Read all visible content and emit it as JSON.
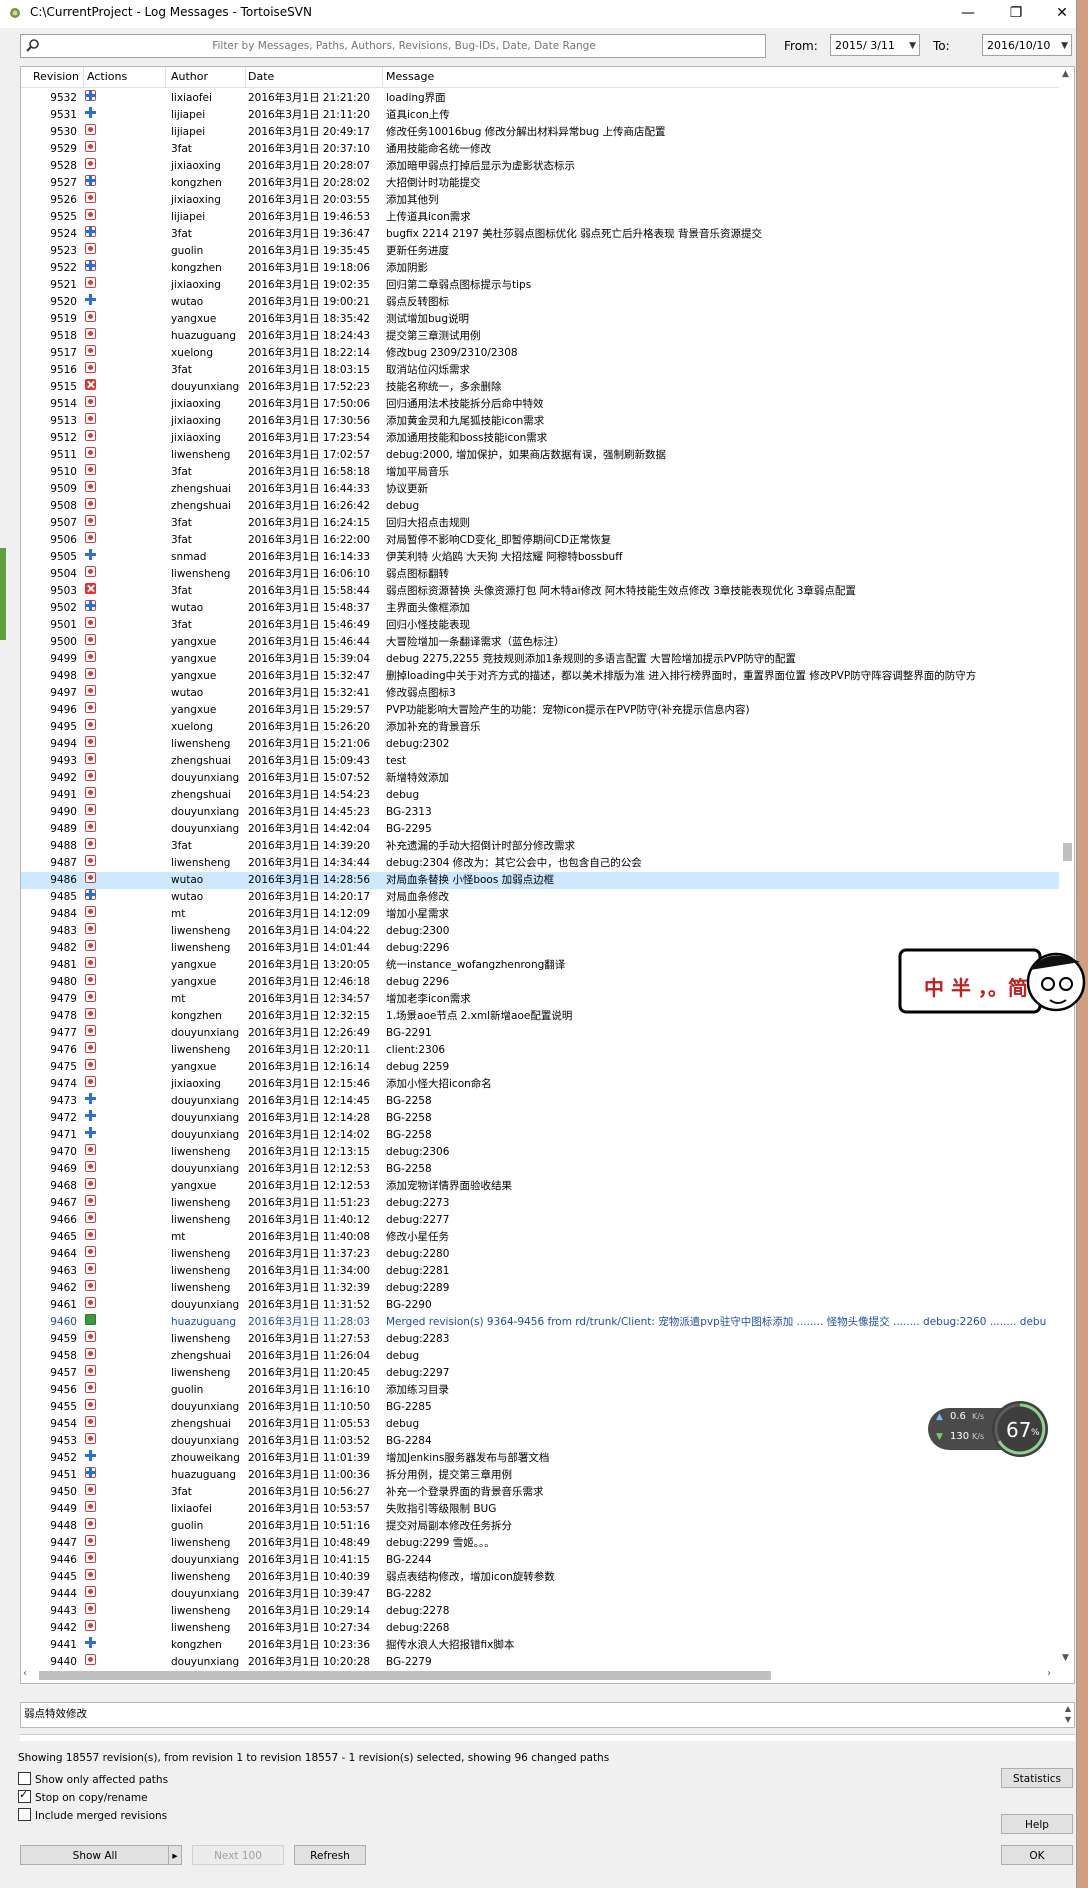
{
  "window": {
    "title": "C:\\CurrentProject - Log Messages - TortoiseSVN",
    "minimize": "—",
    "restore": "❐",
    "close": "✕"
  },
  "filter": {
    "placeholder": "Filter by Messages, Paths, Authors, Revisions, Bug-IDs, Date, Date Range",
    "from_label": "From:",
    "from_value": "2015/ 3/11",
    "to_label": "To:",
    "to_value": "2016/10/10"
  },
  "columns": {
    "revision": "Revision",
    "actions": "Actions",
    "author": "Author",
    "date": "Date",
    "message": "Message"
  },
  "rows": [
    {
      "rev": "9532",
      "a": [
        "mod",
        "add"
      ],
      "author": "lixiaofei",
      "date": "2016年3月1日 21:21:20",
      "msg": "loading界面"
    },
    {
      "rev": "9531",
      "a": [
        "",
        "add"
      ],
      "author": "lijiapei",
      "date": "2016年3月1日 21:11:20",
      "msg": "道具icon上传"
    },
    {
      "rev": "9530",
      "a": [
        "mod"
      ],
      "author": "lijiapei",
      "date": "2016年3月1日 20:49:17",
      "msg": "修改任务10016bug 修改分解出材料异常bug 上传商店配置"
    },
    {
      "rev": "9529",
      "a": [
        "mod"
      ],
      "author": "3fat",
      "date": "2016年3月1日 20:37:10",
      "msg": "通用技能命名统一修改"
    },
    {
      "rev": "9528",
      "a": [
        "mod"
      ],
      "author": "jixiaoxing",
      "date": "2016年3月1日 20:28:07",
      "msg": "添加暗甲弱点打掉后显示为虚影状态标示"
    },
    {
      "rev": "9527",
      "a": [
        "mod",
        "add"
      ],
      "author": "kongzhen",
      "date": "2016年3月1日 20:28:02",
      "msg": "大招倒计时功能提交"
    },
    {
      "rev": "9526",
      "a": [
        "mod"
      ],
      "author": "jixiaoxing",
      "date": "2016年3月1日 20:03:55",
      "msg": "添加其他列"
    },
    {
      "rev": "9525",
      "a": [
        "mod"
      ],
      "author": "lijiapei",
      "date": "2016年3月1日 19:46:53",
      "msg": "上传道具icon需求"
    },
    {
      "rev": "9524",
      "a": [
        "mod",
        "add"
      ],
      "author": "3fat",
      "date": "2016年3月1日 19:36:47",
      "msg": "bugfix 2214 2197 美杜莎弱点图标优化 弱点死亡后升格表现 背景音乐资源提交"
    },
    {
      "rev": "9523",
      "a": [
        "mod"
      ],
      "author": "guolin",
      "date": "2016年3月1日 19:35:45",
      "msg": "更新任务进度"
    },
    {
      "rev": "9522",
      "a": [
        "mod",
        "add"
      ],
      "author": "kongzhen",
      "date": "2016年3月1日 19:18:06",
      "msg": "添加阴影"
    },
    {
      "rev": "9521",
      "a": [
        "mod"
      ],
      "author": "jixiaoxing",
      "date": "2016年3月1日 19:02:35",
      "msg": "回归第二章弱点图标提示与tips"
    },
    {
      "rev": "9520",
      "a": [
        "",
        "add"
      ],
      "author": "wutao",
      "date": "2016年3月1日 19:00:21",
      "msg": "弱点反转图标"
    },
    {
      "rev": "9519",
      "a": [
        "mod"
      ],
      "author": "yangxue",
      "date": "2016年3月1日 18:35:42",
      "msg": "测试增加bug说明"
    },
    {
      "rev": "9518",
      "a": [
        "mod"
      ],
      "author": "huazuguang",
      "date": "2016年3月1日 18:24:43",
      "msg": "提交第三章测试用例"
    },
    {
      "rev": "9517",
      "a": [
        "mod"
      ],
      "author": "xuelong",
      "date": "2016年3月1日 18:22:14",
      "msg": "修改bug 2309/2310/2308"
    },
    {
      "rev": "9516",
      "a": [
        "mod"
      ],
      "author": "3fat",
      "date": "2016年3月1日 18:03:15",
      "msg": "取消站位闪烁需求"
    },
    {
      "rev": "9515",
      "a": [
        "",
        "add",
        "del"
      ],
      "author": "douyunxiang",
      "date": "2016年3月1日 17:52:23",
      "msg": "技能名称统一，多余删除"
    },
    {
      "rev": "9514",
      "a": [
        "mod"
      ],
      "author": "jixiaoxing",
      "date": "2016年3月1日 17:50:06",
      "msg": "回归通用法术技能拆分后命中特效"
    },
    {
      "rev": "9513",
      "a": [
        "mod"
      ],
      "author": "jixiaoxing",
      "date": "2016年3月1日 17:30:56",
      "msg": "添加黄金灵和九尾狐技能icon需求"
    },
    {
      "rev": "9512",
      "a": [
        "mod"
      ],
      "author": "jixiaoxing",
      "date": "2016年3月1日 17:23:54",
      "msg": "添加通用技能和boss技能icon需求"
    },
    {
      "rev": "9511",
      "a": [
        "mod"
      ],
      "author": "liwensheng",
      "date": "2016年3月1日 17:02:57",
      "msg": "debug:2000, 增加保护，如果商店数据有误，强制刷新数据"
    },
    {
      "rev": "9510",
      "a": [
        "mod"
      ],
      "author": "3fat",
      "date": "2016年3月1日 16:58:18",
      "msg": "增加平局音乐"
    },
    {
      "rev": "9509",
      "a": [
        "mod"
      ],
      "author": "zhengshuai",
      "date": "2016年3月1日 16:44:33",
      "msg": "协议更新"
    },
    {
      "rev": "9508",
      "a": [
        "mod"
      ],
      "author": "zhengshuai",
      "date": "2016年3月1日 16:26:42",
      "msg": "debug"
    },
    {
      "rev": "9507",
      "a": [
        "mod"
      ],
      "author": "3fat",
      "date": "2016年3月1日 16:24:15",
      "msg": "回归大招点击规则"
    },
    {
      "rev": "9506",
      "a": [
        "mod"
      ],
      "author": "3fat",
      "date": "2016年3月1日 16:22:00",
      "msg": "对局暂停不影响CD变化_即暂停期间CD正常恢复"
    },
    {
      "rev": "9505",
      "a": [
        "",
        "add"
      ],
      "author": "snmad",
      "date": "2016年3月1日 16:14:33",
      "msg": "伊芙利特 火焰鸥 大天狗 大招炫耀 阿穆特bossbuff"
    },
    {
      "rev": "9504",
      "a": [
        "mod"
      ],
      "author": "liwensheng",
      "date": "2016年3月1日 16:06:10",
      "msg": "弱点图标翻转"
    },
    {
      "rev": "9503",
      "a": [
        "mod",
        "add",
        "del"
      ],
      "author": "3fat",
      "date": "2016年3月1日 15:58:44",
      "msg": "弱点图标资源替换 头像资源打包 阿木特ai修改 阿木特技能生效点修改 3章技能表现优化 3章弱点配置"
    },
    {
      "rev": "9502",
      "a": [
        "mod",
        "add"
      ],
      "author": "wutao",
      "date": "2016年3月1日 15:48:37",
      "msg": "主界面头像框添加"
    },
    {
      "rev": "9501",
      "a": [
        "mod"
      ],
      "author": "3fat",
      "date": "2016年3月1日 15:46:49",
      "msg": "回归小怪技能表现"
    },
    {
      "rev": "9500",
      "a": [
        "mod"
      ],
      "author": "yangxue",
      "date": "2016年3月1日 15:46:44",
      "msg": "大冒险增加一条翻译需求（蓝色标注）"
    },
    {
      "rev": "9499",
      "a": [
        "mod"
      ],
      "author": "yangxue",
      "date": "2016年3月1日 15:39:04",
      "msg": "debug 2275,2255 竞技规则添加1条规则的多语言配置 大冒险增加提示PVP防守的配置"
    },
    {
      "rev": "9498",
      "a": [
        "mod"
      ],
      "author": "yangxue",
      "date": "2016年3月1日 15:32:47",
      "msg": "删掉loading中关于对齐方式的描述，都以美术排版为准   进入排行榜界面时，重置界面位置   修改PVP防守阵容调整界面的防守方"
    },
    {
      "rev": "9497",
      "a": [
        "mod"
      ],
      "author": "wutao",
      "date": "2016年3月1日 15:32:41",
      "msg": "修改弱点图标3"
    },
    {
      "rev": "9496",
      "a": [
        "mod"
      ],
      "author": "yangxue",
      "date": "2016年3月1日 15:29:57",
      "msg": "PVP功能影响大冒险产生的功能：宠物icon提示在PVP防守(补充提示信息内容)"
    },
    {
      "rev": "9495",
      "a": [
        "mod"
      ],
      "author": "xuelong",
      "date": "2016年3月1日 15:26:20",
      "msg": "添加补充的背景音乐"
    },
    {
      "rev": "9494",
      "a": [
        "mod"
      ],
      "author": "liwensheng",
      "date": "2016年3月1日 15:21:06",
      "msg": "debug:2302"
    },
    {
      "rev": "9493",
      "a": [
        "mod"
      ],
      "author": "zhengshuai",
      "date": "2016年3月1日 15:09:43",
      "msg": "test"
    },
    {
      "rev": "9492",
      "a": [
        "mod"
      ],
      "author": "douyunxiang",
      "date": "2016年3月1日 15:07:52",
      "msg": "新增特效添加"
    },
    {
      "rev": "9491",
      "a": [
        "mod"
      ],
      "author": "zhengshuai",
      "date": "2016年3月1日 14:54:23",
      "msg": "debug"
    },
    {
      "rev": "9490",
      "a": [
        "mod"
      ],
      "author": "douyunxiang",
      "date": "2016年3月1日 14:45:23",
      "msg": "BG-2313"
    },
    {
      "rev": "9489",
      "a": [
        "mod"
      ],
      "author": "douyunxiang",
      "date": "2016年3月1日 14:42:04",
      "msg": "BG-2295"
    },
    {
      "rev": "9488",
      "a": [
        "mod"
      ],
      "author": "3fat",
      "date": "2016年3月1日 14:39:20",
      "msg": "补充遗漏的手动大招倒计时部分修改需求"
    },
    {
      "rev": "9487",
      "a": [
        "mod"
      ],
      "author": "liwensheng",
      "date": "2016年3月1日 14:34:44",
      "msg": "debug:2304 修改为：其它公会中，也包含自己的公会"
    },
    {
      "rev": "9486",
      "a": [
        "mod"
      ],
      "author": "wutao",
      "date": "2016年3月1日 14:28:56",
      "msg": "对局血条替换 小怪boos 加弱点边框",
      "sel": true
    },
    {
      "rev": "9485",
      "a": [
        "mod",
        "add"
      ],
      "author": "wutao",
      "date": "2016年3月1日 14:20:17",
      "msg": "对局血条修改"
    },
    {
      "rev": "9484",
      "a": [
        "mod"
      ],
      "author": "mt",
      "date": "2016年3月1日 14:12:09",
      "msg": "增加小星需求"
    },
    {
      "rev": "9483",
      "a": [
        "mod"
      ],
      "author": "liwensheng",
      "date": "2016年3月1日 14:04:22",
      "msg": "debug:2300"
    },
    {
      "rev": "9482",
      "a": [
        "mod"
      ],
      "author": "liwensheng",
      "date": "2016年3月1日 14:01:44",
      "msg": "debug:2296"
    },
    {
      "rev": "9481",
      "a": [
        "mod"
      ],
      "author": "yangxue",
      "date": "2016年3月1日 13:20:05",
      "msg": "统一instance_wofangzhenrong翻译"
    },
    {
      "rev": "9480",
      "a": [
        "mod"
      ],
      "author": "yangxue",
      "date": "2016年3月1日 12:46:18",
      "msg": "debug 2296"
    },
    {
      "rev": "9479",
      "a": [
        "mod"
      ],
      "author": "mt",
      "date": "2016年3月1日 12:34:57",
      "msg": "增加老李icon需求"
    },
    {
      "rev": "9478",
      "a": [
        "mod"
      ],
      "author": "kongzhen",
      "date": "2016年3月1日 12:32:15",
      "msg": "1.场景aoe节点 2.xml新增aoe配置说明"
    },
    {
      "rev": "9477",
      "a": [
        "mod"
      ],
      "author": "douyunxiang",
      "date": "2016年3月1日 12:26:49",
      "msg": "BG-2291"
    },
    {
      "rev": "9476",
      "a": [
        "mod"
      ],
      "author": "liwensheng",
      "date": "2016年3月1日 12:20:11",
      "msg": "client:2306"
    },
    {
      "rev": "9475",
      "a": [
        "mod"
      ],
      "author": "yangxue",
      "date": "2016年3月1日 12:16:14",
      "msg": "debug 2259"
    },
    {
      "rev": "9474",
      "a": [
        "mod"
      ],
      "author": "jixiaoxing",
      "date": "2016年3月1日 12:15:46",
      "msg": "添加小怪大招icon命名"
    },
    {
      "rev": "9473",
      "a": [
        "",
        "add"
      ],
      "author": "douyunxiang",
      "date": "2016年3月1日 12:14:45",
      "msg": "BG-2258"
    },
    {
      "rev": "9472",
      "a": [
        "",
        "add"
      ],
      "author": "douyunxiang",
      "date": "2016年3月1日 12:14:28",
      "msg": "BG-2258"
    },
    {
      "rev": "9471",
      "a": [
        "",
        "add"
      ],
      "author": "douyunxiang",
      "date": "2016年3月1日 12:14:02",
      "msg": "BG-2258"
    },
    {
      "rev": "9470",
      "a": [
        "mod"
      ],
      "author": "liwensheng",
      "date": "2016年3月1日 12:13:15",
      "msg": "debug:2306"
    },
    {
      "rev": "9469",
      "a": [
        "mod"
      ],
      "author": "douyunxiang",
      "date": "2016年3月1日 12:12:53",
      "msg": "BG-2258"
    },
    {
      "rev": "9468",
      "a": [
        "mod"
      ],
      "author": "yangxue",
      "date": "2016年3月1日 12:12:53",
      "msg": "添加宠物详情界面验收结果"
    },
    {
      "rev": "9467",
      "a": [
        "mod"
      ],
      "author": "liwensheng",
      "date": "2016年3月1日 11:51:23",
      "msg": "debug:2273"
    },
    {
      "rev": "9466",
      "a": [
        "mod"
      ],
      "author": "liwensheng",
      "date": "2016年3月1日 11:40:12",
      "msg": "debug:2277"
    },
    {
      "rev": "9465",
      "a": [
        "mod"
      ],
      "author": "mt",
      "date": "2016年3月1日 11:40:08",
      "msg": "修改小星任务"
    },
    {
      "rev": "9464",
      "a": [
        "mod"
      ],
      "author": "liwensheng",
      "date": "2016年3月1日 11:37:23",
      "msg": "debug:2280"
    },
    {
      "rev": "9463",
      "a": [
        "mod"
      ],
      "author": "liwensheng",
      "date": "2016年3月1日 11:34:00",
      "msg": "debug:2281"
    },
    {
      "rev": "9462",
      "a": [
        "mod"
      ],
      "author": "liwensheng",
      "date": "2016年3月1日 11:32:39",
      "msg": "debug:2289"
    },
    {
      "rev": "9461",
      "a": [
        "mod"
      ],
      "author": "douyunxiang",
      "date": "2016年3月1日 11:31:52",
      "msg": "BG-2290"
    },
    {
      "rev": "9460",
      "a": [
        "mod",
        "add",
        "del",
        "rep"
      ],
      "author": "huazuguang",
      "date": "2016年3月1日 11:28:03",
      "msg": "Merged revision(s) 9364-9456 from rd/trunk/Client: 宠物派遣pvp驻守中图标添加 ........ 怪物头像提交 ........ debug:2260 ........ debu",
      "merge": true
    },
    {
      "rev": "9459",
      "a": [
        "mod"
      ],
      "author": "liwensheng",
      "date": "2016年3月1日 11:27:53",
      "msg": "debug:2283"
    },
    {
      "rev": "9458",
      "a": [
        "mod"
      ],
      "author": "zhengshuai",
      "date": "2016年3月1日 11:26:04",
      "msg": "debug"
    },
    {
      "rev": "9457",
      "a": [
        "mod"
      ],
      "author": "liwensheng",
      "date": "2016年3月1日 11:20:45",
      "msg": "debug:2297"
    },
    {
      "rev": "9456",
      "a": [
        "mod"
      ],
      "author": "guolin",
      "date": "2016年3月1日 11:16:10",
      "msg": "添加练习目录"
    },
    {
      "rev": "9455",
      "a": [
        "mod"
      ],
      "author": "douyunxiang",
      "date": "2016年3月1日 11:10:50",
      "msg": "BG-2285"
    },
    {
      "rev": "9454",
      "a": [
        "mod"
      ],
      "author": "zhengshuai",
      "date": "2016年3月1日 11:05:53",
      "msg": "debug"
    },
    {
      "rev": "9453",
      "a": [
        "mod"
      ],
      "author": "douyunxiang",
      "date": "2016年3月1日 11:03:52",
      "msg": "BG-2284"
    },
    {
      "rev": "9452",
      "a": [
        "",
        "add"
      ],
      "author": "zhouweikang",
      "date": "2016年3月1日 11:01:39",
      "msg": "增加Jenkins服务器发布与部署文档"
    },
    {
      "rev": "9451",
      "a": [
        "mod",
        "add"
      ],
      "author": "huazuguang",
      "date": "2016年3月1日 11:00:36",
      "msg": "拆分用例，提交第三章用例"
    },
    {
      "rev": "9450",
      "a": [
        "mod"
      ],
      "author": "3fat",
      "date": "2016年3月1日 10:56:27",
      "msg": "补充一个登录界面的背景音乐需求"
    },
    {
      "rev": "9449",
      "a": [
        "mod"
      ],
      "author": "lixiaofei",
      "date": "2016年3月1日 10:53:57",
      "msg": "失败指引等级限制 BUG"
    },
    {
      "rev": "9448",
      "a": [
        "mod"
      ],
      "author": "guolin",
      "date": "2016年3月1日 10:51:16",
      "msg": "提交对局副本修改任务拆分"
    },
    {
      "rev": "9447",
      "a": [
        "mod"
      ],
      "author": "liwensheng",
      "date": "2016年3月1日 10:48:49",
      "msg": "debug:2299 雪姬。。。"
    },
    {
      "rev": "9446",
      "a": [
        "mod"
      ],
      "author": "douyunxiang",
      "date": "2016年3月1日 10:41:15",
      "msg": "BG-2244"
    },
    {
      "rev": "9445",
      "a": [
        "mod"
      ],
      "author": "liwensheng",
      "date": "2016年3月1日 10:40:39",
      "msg": "弱点表结构修改，增加icon旋转参数"
    },
    {
      "rev": "9444",
      "a": [
        "mod"
      ],
      "author": "douyunxiang",
      "date": "2016年3月1日 10:39:47",
      "msg": "BG-2282"
    },
    {
      "rev": "9443",
      "a": [
        "mod"
      ],
      "author": "liwensheng",
      "date": "2016年3月1日 10:29:14",
      "msg": "debug:2278"
    },
    {
      "rev": "9442",
      "a": [
        "mod"
      ],
      "author": "liwensheng",
      "date": "2016年3月1日 10:27:34",
      "msg": "debug:2268"
    },
    {
      "rev": "9441",
      "a": [
        "",
        "add"
      ],
      "author": "kongzhen",
      "date": "2016年3月1日 10:23:36",
      "msg": "掘传水浪人大招报错fix脚本"
    },
    {
      "rev": "9440",
      "a": [
        "mod"
      ],
      "author": "douyunxiang",
      "date": "2016年3月1日 10:20:28",
      "msg": "BG-2279"
    }
  ],
  "message_panel": {
    "text": "弱点特效修改"
  },
  "status": {
    "text": "Showing 18557 revision(s), from revision 1 to revision 18557 - 1 revision(s) selected, showing 96 changed paths"
  },
  "options": {
    "affected_paths": "Show only affected paths",
    "stop_on_copy": "Stop on copy/rename",
    "include_merged": "Include merged revisions",
    "affected_checked": false,
    "stop_checked": true,
    "merged_checked": false
  },
  "buttons": {
    "show_all": "Show All",
    "next_100": "Next 100",
    "refresh": "Refresh",
    "statistics": "Statistics",
    "help": "Help",
    "ok": "OK"
  },
  "overlay": {
    "sticker_text": "中 半 ，。简",
    "speed_up": "0.6",
    "speed_down": "130",
    "speed_unit": "K/s",
    "percent": "67",
    "percent_unit": "%"
  }
}
